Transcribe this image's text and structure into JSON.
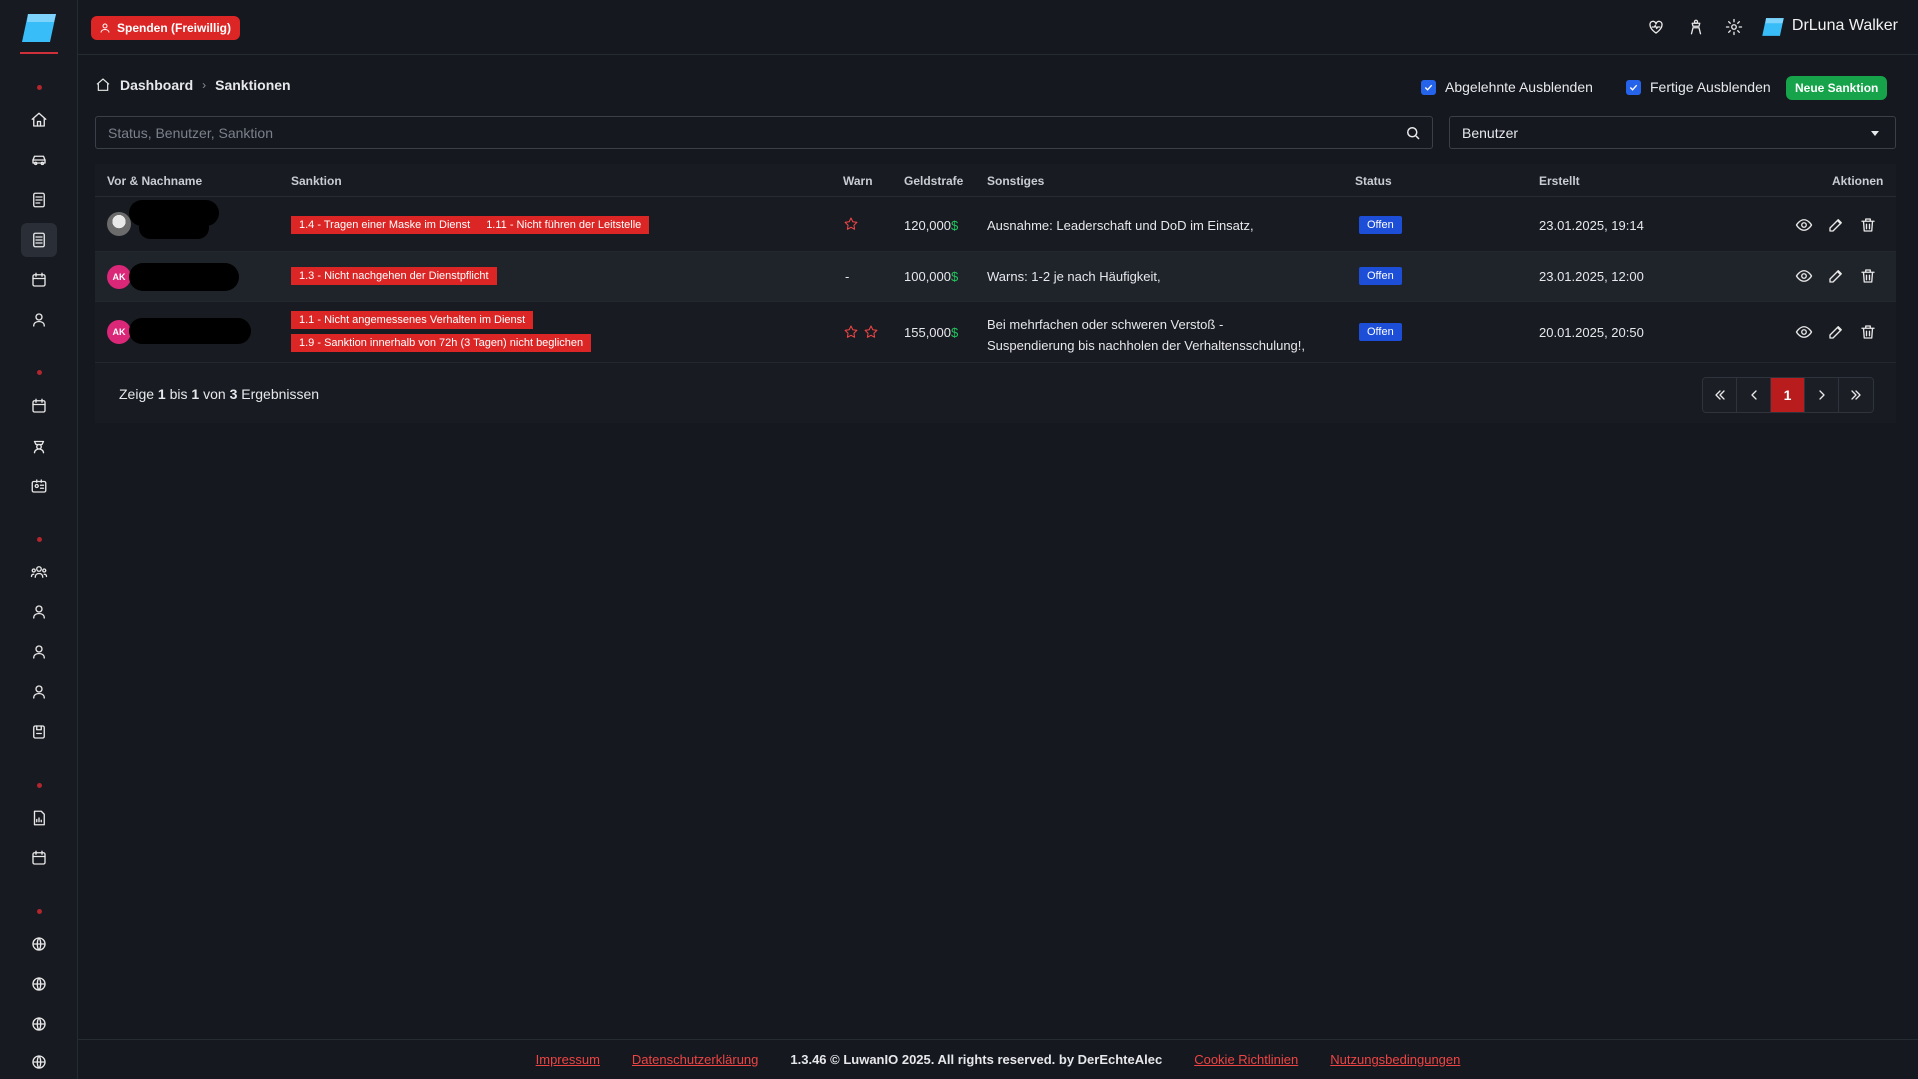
{
  "topbar": {
    "donate_label": "Spenden (Freiwillig)",
    "user_name": "DrLuna Walker"
  },
  "breadcrumb": {
    "home": "Dashboard",
    "current": "Sanktionen"
  },
  "filters": {
    "hide_rejected": "Abgelehnte Ausblenden",
    "hide_done": "Fertige Ausblenden",
    "new_button": "Neue Sanktion",
    "search_placeholder": "Status, Benutzer, Sanktion",
    "user_select": "Benutzer"
  },
  "table": {
    "headers": {
      "name": "Vor & Nachname",
      "sanction": "Sanktion",
      "warn": "Warn",
      "fine": "Geldstrafe",
      "other": "Sonstiges",
      "status": "Status",
      "created": "Erstellt",
      "actions": "Aktionen"
    },
    "rows": [
      {
        "avatar": "",
        "sanctions": [
          "1.4 - Tragen einer Maske im Dienst",
          "1.11 - Nicht führen der Leitstelle"
        ],
        "warn_stars": 1,
        "warn_text": "",
        "fine": "120,000",
        "currency": "$",
        "other": "Ausnahme: Leaderschaft und DoD im Einsatz,",
        "status": "Offen",
        "created": "23.01.2025, 19:14"
      },
      {
        "avatar": "AK",
        "sanctions": [
          "1.3 - Nicht nachgehen der Dienstpflicht"
        ],
        "warn_stars": 0,
        "warn_text": "-",
        "fine": "100,000",
        "currency": "$",
        "other": "Warns: 1-2 je nach Häufigkeit,",
        "status": "Offen",
        "created": "23.01.2025, 12:00"
      },
      {
        "avatar": "AK",
        "sanctions": [
          "1.1 - Nicht angemessenes Verhalten im Dienst",
          "1.9 - Sanktion innerhalb von 72h (3 Tagen) nicht beglichen"
        ],
        "warn_stars": 2,
        "warn_text": "",
        "fine": "155,000",
        "currency": "$",
        "other_line1": "Bei mehrfachen oder schweren Verstoß -",
        "other_line2": "Suspendierung bis nachholen der Verhaltensschulung!,",
        "status": "Offen",
        "created": "20.01.2025, 20:50"
      }
    ]
  },
  "pagination": {
    "prefix": "Zeige",
    "from": "1",
    "to_word": "bis",
    "to": "1",
    "of_word": "von",
    "total": "3",
    "suffix": "Ergebnissen",
    "current_page": "1"
  },
  "footer": {
    "impressum": "Impressum",
    "privacy": "Datenschutzerklärung",
    "copyright": "1.3.46 © LuwanIO 2025. All rights reserved. by DerEchteAlec",
    "cookies": "Cookie Richtlinien",
    "terms": "Nutzungsbedingungen"
  },
  "colors": {
    "accent_red": "#dc2626",
    "success_green": "#16a34a",
    "status_blue": "#1d4ed8",
    "background": "#15181e"
  }
}
